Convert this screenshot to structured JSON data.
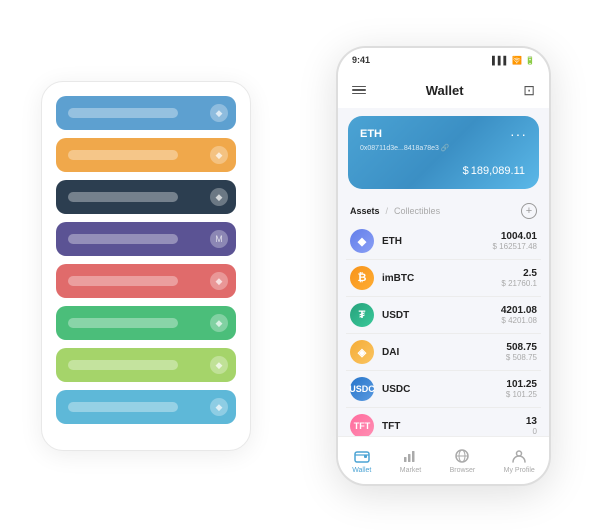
{
  "scene": {
    "bg_card": {
      "rows": [
        {
          "id": "blue",
          "class": "row-blue"
        },
        {
          "id": "orange",
          "class": "row-orange"
        },
        {
          "id": "dark",
          "class": "row-dark"
        },
        {
          "id": "purple",
          "class": "row-purple"
        },
        {
          "id": "red",
          "class": "row-red"
        },
        {
          "id": "green",
          "class": "row-green"
        },
        {
          "id": "lightgreen",
          "class": "row-lightgreen"
        },
        {
          "id": "lblue",
          "class": "row-lblue"
        }
      ]
    },
    "phone": {
      "status_bar": {
        "time": "9:41",
        "signal": "▌▌▌",
        "wifi": "WiFi",
        "battery": "⬜"
      },
      "header": {
        "menu_icon": "≡",
        "title": "Wallet",
        "expand_icon": "⊡"
      },
      "wallet_card": {
        "coin": "ETH",
        "dots": "···",
        "address": "0x08711d3e...8418a78e3 🔗",
        "balance_prefix": "$",
        "balance": "189,089.11"
      },
      "assets_section": {
        "tab_active": "Assets",
        "tab_slash": "/",
        "tab_inactive": "Collectibles",
        "add_icon": "+"
      },
      "assets": [
        {
          "symbol": "ETH",
          "name": "ETH",
          "icon_class": "icon-eth",
          "icon_text": "◆",
          "amount": "1004.01",
          "usd": "$ 162517.48"
        },
        {
          "symbol": "imBTC",
          "name": "imBTC",
          "icon_class": "icon-imbtc",
          "icon_text": "₿",
          "amount": "2.5",
          "usd": "$ 21760.1"
        },
        {
          "symbol": "USDT",
          "name": "USDT",
          "icon_class": "icon-usdt",
          "icon_text": "₮",
          "amount": "4201.08",
          "usd": "$ 4201.08"
        },
        {
          "symbol": "DAI",
          "name": "DAI",
          "icon_class": "icon-dai",
          "icon_text": "◈",
          "amount": "508.75",
          "usd": "$ 508.75"
        },
        {
          "symbol": "USDC",
          "name": "USDC",
          "icon_class": "icon-usdc",
          "icon_text": "©",
          "amount": "101.25",
          "usd": "$ 101.25"
        },
        {
          "symbol": "TFT",
          "name": "TFT",
          "icon_class": "icon-tft",
          "icon_text": "🌱",
          "amount": "13",
          "usd": "0"
        }
      ],
      "nav": [
        {
          "id": "wallet",
          "label": "Wallet",
          "active": true,
          "icon": "👛"
        },
        {
          "id": "market",
          "label": "Market",
          "active": false,
          "icon": "📊"
        },
        {
          "id": "browser",
          "label": "Browser",
          "active": false,
          "icon": "🌐"
        },
        {
          "id": "profile",
          "label": "My Profile",
          "active": false,
          "icon": "👤"
        }
      ]
    }
  }
}
